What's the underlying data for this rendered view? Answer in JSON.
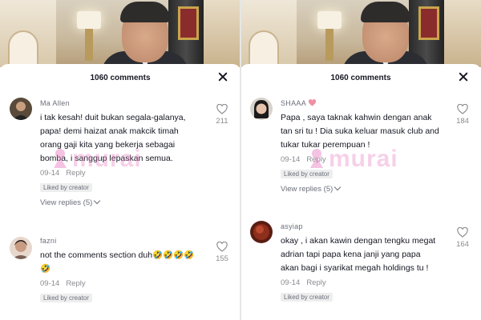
{
  "left": {
    "header": {
      "comments_count": "1060 comments"
    },
    "comments": [
      {
        "username": "Ma Allen",
        "text": "i tak kesah! duit bukan segala-galanya, papa! demi haizat anak makcik timah orang gaji kita yang bekerja sebagai bomba, i sanggup lepaskan semua.",
        "date": "09-14",
        "reply_label": "Reply",
        "liked_badge": "Liked by creator",
        "view_replies": "View replies (5)",
        "likes": "211"
      },
      {
        "username": "fazni",
        "text": "not the comments section duh🤣🤣🤣🤣🤣",
        "date": "09-14",
        "reply_label": "Reply",
        "liked_badge": "Liked by creator",
        "likes": "155"
      }
    ],
    "watermark": "murai"
  },
  "right": {
    "header": {
      "comments_count": "1060 comments"
    },
    "comments": [
      {
        "username": "SHAAA",
        "text": "Papa , saya taknak kahwin dengan anak tan sri tu ! Dia suka keluar masuk club and tukar tukar perempuan !",
        "date": "09-14",
        "reply_label": "Reply",
        "liked_badge": "Liked by creator",
        "view_replies": "View replies (5)",
        "likes": "184"
      },
      {
        "username": "asyiap",
        "text": "okay , i akan kawin dengan tengku megat adrian tapi papa kena janji yang papa akan bagi i syarikat megah holdings tu !",
        "date": "09-14",
        "reply_label": "Reply",
        "liked_badge": "Liked by creator",
        "likes": "164"
      }
    ],
    "watermark": "murai"
  },
  "icons": {
    "close": "close-icon",
    "like": "heart-outline-icon",
    "chevron": "chevron-down-icon",
    "badge": "heart-icon"
  },
  "colors": {
    "text": "#161823",
    "muted": "#8a8b91",
    "watermark": "#e678be",
    "badge_heart": "#f08fa2"
  }
}
